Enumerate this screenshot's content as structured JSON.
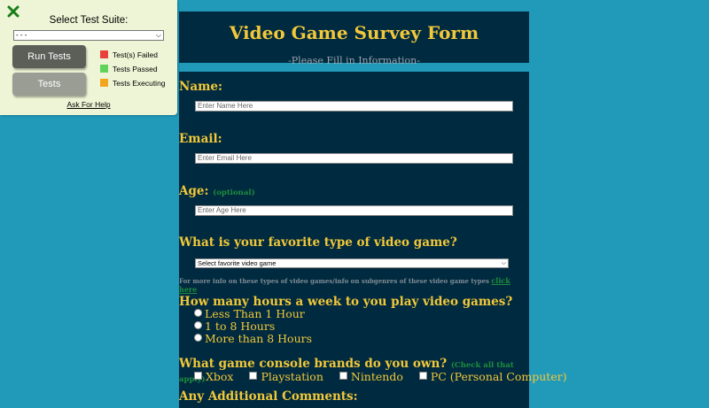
{
  "test_panel": {
    "title": "Select Test Suite:",
    "suite_select_value": "- - -",
    "run_button": "Run Tests",
    "tests_button": "Tests",
    "legend": [
      {
        "label": "Test(s) Failed",
        "color": "#e8413b"
      },
      {
        "label": "Tests Passed",
        "color": "#5fd35c"
      },
      {
        "label": "Tests Executing",
        "color": "#f2a51e"
      }
    ],
    "help_link": "Ask For Help"
  },
  "header": {
    "title": "Video Game Survey Form",
    "subtitle": "-Please Fill in Information-"
  },
  "form": {
    "name_label": "Name:",
    "name_placeholder": "Enter Name Here",
    "email_label": "Email:",
    "email_placeholder": "Enter Email Here",
    "age_label": "Age:",
    "age_optional": "(optional)",
    "age_placeholder": "Enter Age Here",
    "type_label": "What is your favorite type of video game?",
    "type_select_value": "Select favorite video game",
    "info_note": "For more info on these types of video games/info on subgenres of these video game types",
    "info_link": "click here",
    "hours_label": "How many hours a week to you play video games?",
    "hours_options": [
      "Less Than 1 Hour",
      "1 to 8 Hours",
      "More than 8 Hours"
    ],
    "console_label": "What game console brands do you own?",
    "console_note": "(Check all that apply)",
    "console_options": [
      "Xbox",
      "Playstation",
      "Nintendo",
      "PC (Personal Computer)"
    ],
    "comments_label": "Any Additional Comments:"
  }
}
